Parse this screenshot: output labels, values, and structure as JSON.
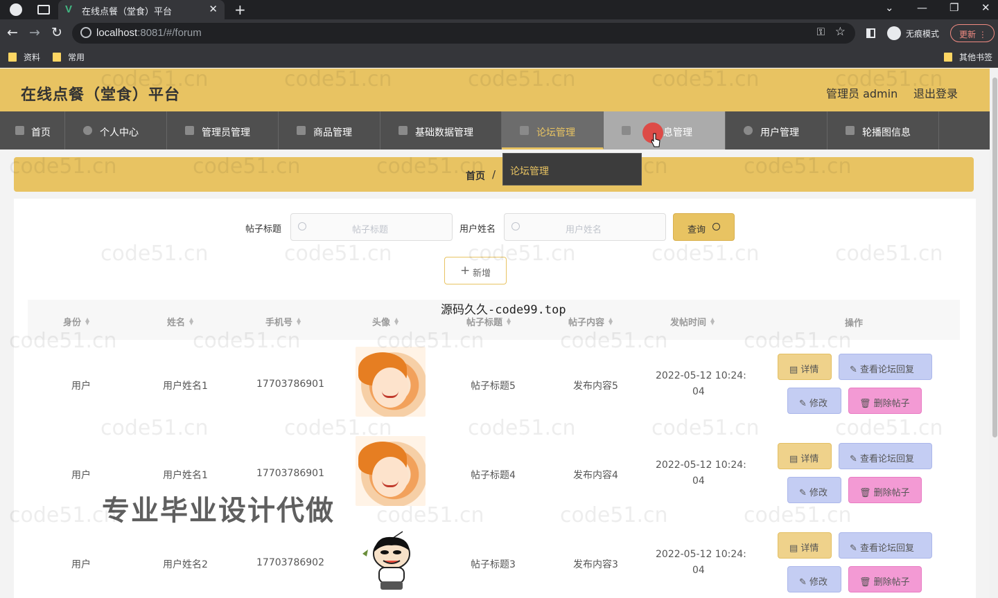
{
  "browser": {
    "tab_title": "在线点餐（堂食）平台",
    "tab_favicon": "V",
    "new_tab": "+",
    "url_host": "localhost",
    "url_rest": ":8081/#/forum",
    "incognito_label": "无痕模式",
    "update_label": "更新",
    "bookmarks": [
      "资料",
      "常用"
    ],
    "other_bookmarks": "其他书签"
  },
  "header": {
    "title": "在线点餐（堂食）平台",
    "user": "管理员 admin",
    "logout": "退出登录"
  },
  "menu": {
    "items": [
      "首页",
      "个人中心",
      "管理员管理",
      "商品管理",
      "基础数据管理",
      "论坛管理",
      "公告信息管理",
      "用户管理",
      "轮播图信息"
    ],
    "visible_hover_label": "息管理",
    "dropdown_item": "论坛管理"
  },
  "breadcrumb": {
    "home": "首页",
    "sep": "/"
  },
  "search": {
    "title_label": "帖子标题",
    "title_placeholder": "帖子标题",
    "user_label": "用户姓名",
    "user_placeholder": "用户姓名",
    "query_label": "查询",
    "add_label": "新增"
  },
  "table": {
    "headers": [
      "身份",
      "姓名",
      "手机号",
      "头像",
      "帖子标题",
      "帖子内容",
      "发帖时间",
      "操作"
    ],
    "rows": [
      {
        "role": "用户",
        "name": "用户姓名1",
        "phone": "17703786901",
        "avatar": "woman-photo",
        "title": "帖子标题5",
        "content": "发布内容5",
        "time_a": "2022-05-12 10:24:",
        "time_b": "04"
      },
      {
        "role": "用户",
        "name": "用户姓名1",
        "phone": "17703786901",
        "avatar": "woman-photo",
        "title": "帖子标题4",
        "content": "发布内容4",
        "time_a": "2022-05-12 10:24:",
        "time_b": "04"
      },
      {
        "role": "用户",
        "name": "用户姓名2",
        "phone": "17703786902",
        "avatar": "cartoon-boy",
        "title": "帖子标题3",
        "content": "发布内容3",
        "time_a": "2022-05-12 10:24:",
        "time_b": "04"
      }
    ],
    "actions": {
      "detail": "详情",
      "replies": "查看论坛回复",
      "edit": "修改",
      "delete": "删除帖子"
    }
  },
  "overlays": {
    "source_watermark": "源码久久-code99.top",
    "promo_watermark": "专业毕业设计代做",
    "site_watermark": "code51.cn"
  },
  "colors": {
    "accent": "#e8c362",
    "menu_bg": "#4f4f4f",
    "replies_btn": "#c4cdf3",
    "delete_btn": "#f39ad4"
  }
}
